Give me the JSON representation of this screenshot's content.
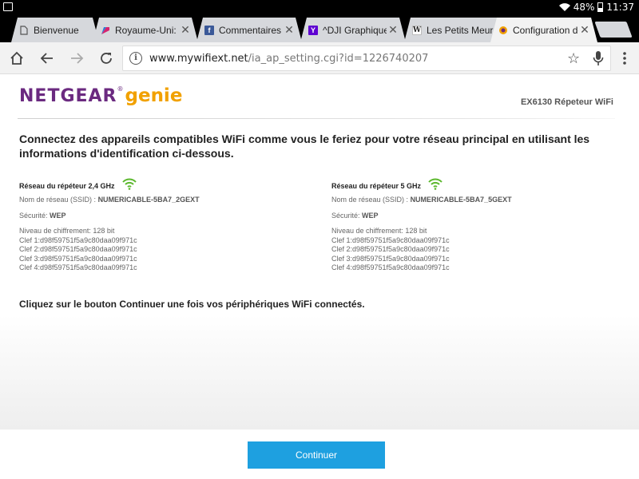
{
  "statusbar": {
    "battery": "48%",
    "time": "11:37"
  },
  "tabs": [
    {
      "title": "Bienvenue",
      "favicon": "page-icon",
      "close": ""
    },
    {
      "title": "Royaume-Uni: gu",
      "favicon": "arrow-logo-icon",
      "close": "✕"
    },
    {
      "title": "Commentaires",
      "favicon": "facebook-icon",
      "close": "✕"
    },
    {
      "title": "^DJI Graphique c",
      "favicon": "yahoo-icon",
      "close": "✕"
    },
    {
      "title": "Les Petits Meur",
      "favicon": "wikipedia-icon",
      "close": "✕"
    },
    {
      "title": "Configuration de",
      "favicon": "netgear-icon",
      "close": "✕"
    }
  ],
  "toolbar": {
    "url_host": "www.mywifiext.net",
    "url_path": "/ia_ap_setting.cgi?id=1226740207"
  },
  "page": {
    "logo_brand": "NETGEAR",
    "logo_product": "genie",
    "logo_reg": "®",
    "device": "EX6130 Répeteur WiFi",
    "intro": "Connectez des appareils compatibles WiFi comme vous le feriez pour votre réseau principal en utilisant les informations d'identification ci-dessous.",
    "networks": [
      {
        "title": "Réseau du répéteur 2,4 GHz",
        "ssid_label": "Nom de réseau (SSID) :",
        "ssid": "NUMERICABLE-5BA7_2GEXT",
        "security_label": "Sécurité:",
        "security": "WEP",
        "encryption": "Niveau de chiffrement: 128 bit",
        "keys": [
          "Clef 1:d98f59751f5a9c80daa09f971c",
          "Clef 2:d98f59751f5a9c80daa09f971c",
          "Clef 3:d98f59751f5a9c80daa09f971c",
          "Clef 4:d98f59751f5a9c80daa09f971c"
        ]
      },
      {
        "title": "Réseau du répéteur 5 GHz",
        "ssid_label": "Nom de réseau (SSID) :",
        "ssid": "NUMERICABLE-5BA7_5GEXT",
        "security_label": "Sécurité:",
        "security": "WEP",
        "encryption": "Niveau de chiffrement: 128 bit",
        "keys": [
          "Clef 1:d98f59751f5a9c80daa09f971c",
          "Clef 2:d98f59751f5a9c80daa09f971c",
          "Clef 3:d98f59751f5a9c80daa09f971c",
          "Clef 4:d98f59751f5a9c80daa09f971c"
        ]
      }
    ],
    "outro": "Cliquez sur le bouton Continuer une fois vos périphériques WiFi connectés."
  },
  "footer": {
    "continue_label": "Continuer"
  },
  "colors": {
    "brand_purple": "#6b2a80",
    "genie_orange": "#f1a100",
    "button_blue": "#1ea0e0",
    "wifi_green": "#5cb82e"
  }
}
